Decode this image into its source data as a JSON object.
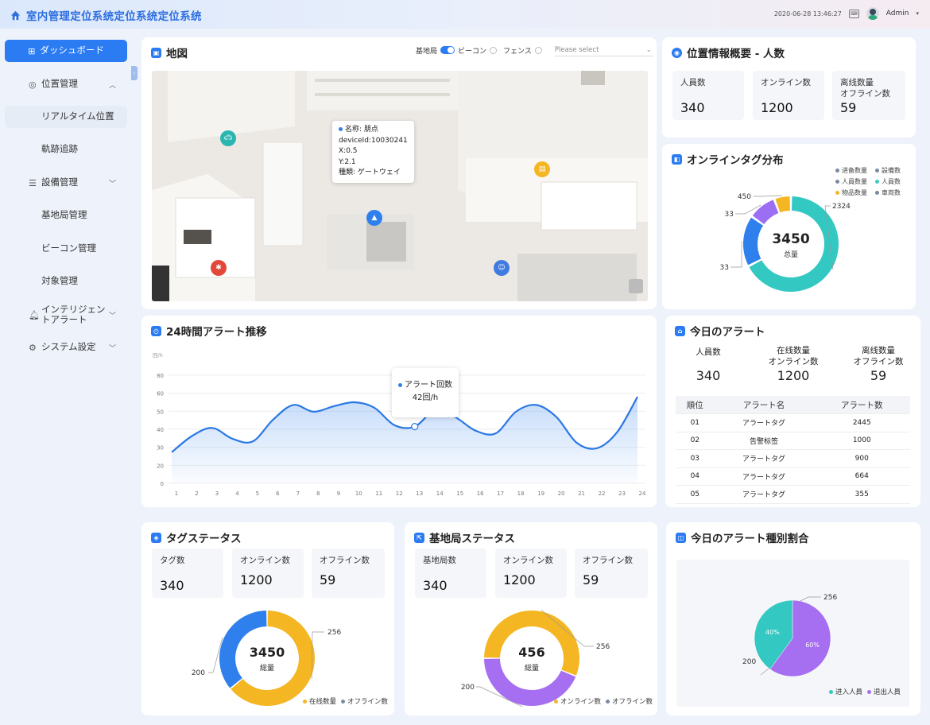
{
  "app": {
    "title": "室内管理定位系统定位系统定位系统",
    "datetime": "2020-06-28 13:46:27",
    "user": "Admin"
  },
  "sidebar": {
    "items": [
      {
        "label": "ダッシュボード",
        "icon": "grid-icon"
      },
      {
        "label": "位置管理",
        "icon": "location-icon"
      },
      {
        "label": "リアルタイム位置"
      },
      {
        "label": "軌跡追跡"
      },
      {
        "label": "設備管理",
        "icon": "list-icon"
      },
      {
        "label": "基地局管理"
      },
      {
        "label": "ビーコン管理"
      },
      {
        "label": "対象管理"
      },
      {
        "label": "インテリジェン\nトアラート",
        "icon": "bell-icon"
      },
      {
        "label": "システム設定",
        "icon": "settings-icon"
      }
    ]
  },
  "map": {
    "title": "地図",
    "filter_base": "基地局",
    "filter_beacon": "ビーコン",
    "filter_fence": "フェンス",
    "select_placeholder": "Please select",
    "tooltip": {
      "name": "名称: 朋点",
      "device": "deviceId:10030241",
      "x": "X:0.5",
      "y": "Y:2.1",
      "kind": "種類: ゲートウェイ"
    }
  },
  "overview": {
    "title": "位置情報概要 - 人数",
    "stats": [
      {
        "label": "人員数",
        "value": "340"
      },
      {
        "label": "オンライン数",
        "value": "1200"
      },
      {
        "label": "离线数量\nオフライン数",
        "value": "59"
      }
    ]
  },
  "tag_dist": {
    "title": "オンラインタグ分布",
    "total": "3450",
    "total_label": "总量",
    "legend": [
      "进备数量",
      "設備数",
      "人員数量",
      "人員数",
      "物品数量",
      "車両数"
    ],
    "legend_colors": [
      "#7b8aa0",
      "#7b8aa0",
      "#7b8aa0",
      "#3cc9c0",
      "#f5b623",
      "#7b8aa0"
    ],
    "slices": [
      {
        "value": 2324,
        "label": "2324",
        "color": "#33c8c2"
      },
      {
        "value": 600,
        "label": "33",
        "color": "#2f80ed"
      },
      {
        "value": 330,
        "label": "33",
        "color": "#9b6ef3"
      },
      {
        "value": 196,
        "label": "450",
        "color": "#f5b623"
      }
    ]
  },
  "trend": {
    "title": "24時間アラート推移",
    "unit": "回/h",
    "tooltip_label": "アラート回数",
    "tooltip_value": "42回/h"
  },
  "chart_data": {
    "type": "area",
    "x": [
      1,
      2,
      3,
      4,
      5,
      6,
      7,
      8,
      9,
      10,
      11,
      12,
      13,
      14,
      15,
      16,
      17,
      18,
      19,
      20,
      21,
      22,
      23,
      24
    ],
    "values": [
      23,
      35,
      41,
      33,
      31,
      47,
      58,
      53,
      57,
      60,
      56,
      43,
      42,
      54,
      49,
      39,
      37,
      53,
      58,
      49,
      30,
      26,
      38,
      64
    ],
    "ylim": [
      0,
      80
    ],
    "yticks": [
      0,
      20,
      30,
      40,
      50,
      60,
      80
    ],
    "grid": true
  },
  "alerts_today": {
    "title": "今日のアラート",
    "stats": [
      {
        "label": "人員数",
        "value": "340"
      },
      {
        "label": "在线数量\nオンライン数",
        "value": "1200"
      },
      {
        "label": "离线数量\nオフライン数",
        "value": "59"
      }
    ],
    "headers": [
      "順位",
      "アラート名",
      "アラート数"
    ],
    "rows": [
      [
        "01",
        "アラートタグ",
        "2445"
      ],
      [
        "02",
        "告警标签",
        "1000"
      ],
      [
        "03",
        "アラートタグ",
        "900"
      ],
      [
        "04",
        "アラートタグ",
        "664"
      ],
      [
        "05",
        "アラートタグ",
        "355"
      ]
    ]
  },
  "tag_status": {
    "title": "タグステータス",
    "stats": [
      {
        "label": "タグ数",
        "value": "340"
      },
      {
        "label": "オンライン数",
        "value": "1200"
      },
      {
        "label": "オフライン数",
        "value": "59"
      }
    ],
    "total": "3450",
    "total_label": "総量",
    "slices": [
      {
        "value": 256,
        "label": "256",
        "color": "#f5b623"
      },
      {
        "value": 144,
        "label": "200",
        "color": "#2f80ed"
      }
    ],
    "legend": [
      "在线数量",
      "オフライン数"
    ],
    "legend_colors": [
      "#f5b623",
      "#7b8aa0"
    ]
  },
  "base_status": {
    "title": "基地局ステータス",
    "stats": [
      {
        "label": "基地局数",
        "value": "340"
      },
      {
        "label": "オンライン数",
        "value": "1200"
      },
      {
        "label": "オフライン数",
        "value": "59"
      }
    ],
    "total": "456",
    "total_label": "総量",
    "slices": [
      {
        "value": 256,
        "label": "256",
        "color": "#f5b623"
      },
      {
        "value": 200,
        "label": "200",
        "color": "#a66ef0"
      }
    ],
    "legend": [
      "オンライン数",
      "オフライン数"
    ],
    "legend_colors": [
      "#f5b623",
      "#7b8aa0"
    ]
  },
  "alert_type": {
    "title": "今日のアラート種別割合",
    "slices": [
      {
        "value": 60,
        "label": "60%",
        "color": "#a66ef0",
        "callout": "256"
      },
      {
        "value": 40,
        "label": "40%",
        "color": "#33c8c2",
        "callout": "200"
      }
    ],
    "legend": [
      "进入人員",
      "退出人員"
    ],
    "legend_colors": [
      "#33c8c2",
      "#a66ef0"
    ]
  }
}
